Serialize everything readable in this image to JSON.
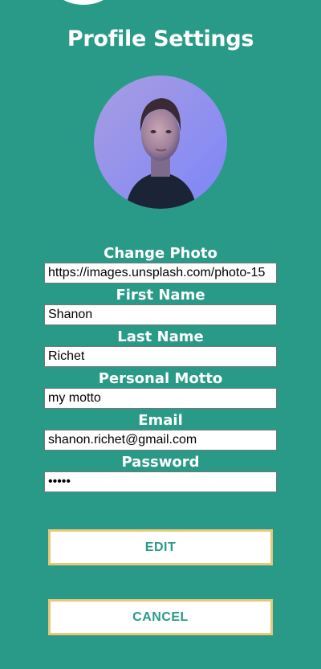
{
  "header": {
    "title": "Profile Settings"
  },
  "profile": {
    "avatar_alt": "profile photo"
  },
  "form": {
    "fields": [
      {
        "label": "Change Photo",
        "value": "https://images.unsplash.com/photo-15"
      },
      {
        "label": "First Name",
        "value": "Shanon"
      },
      {
        "label": "Last Name",
        "value": "Richet"
      },
      {
        "label": "Personal Motto",
        "value": "my motto"
      },
      {
        "label": "Email",
        "value": "shanon.richet@gmail.com"
      },
      {
        "label": "Password",
        "value": "•••••"
      }
    ]
  },
  "actions": {
    "edit_label": "EDIT",
    "cancel_label": "CANCEL"
  },
  "colors": {
    "background": "#2a9a88",
    "button_border": "#e6c878",
    "button_text": "#2a9a88"
  }
}
